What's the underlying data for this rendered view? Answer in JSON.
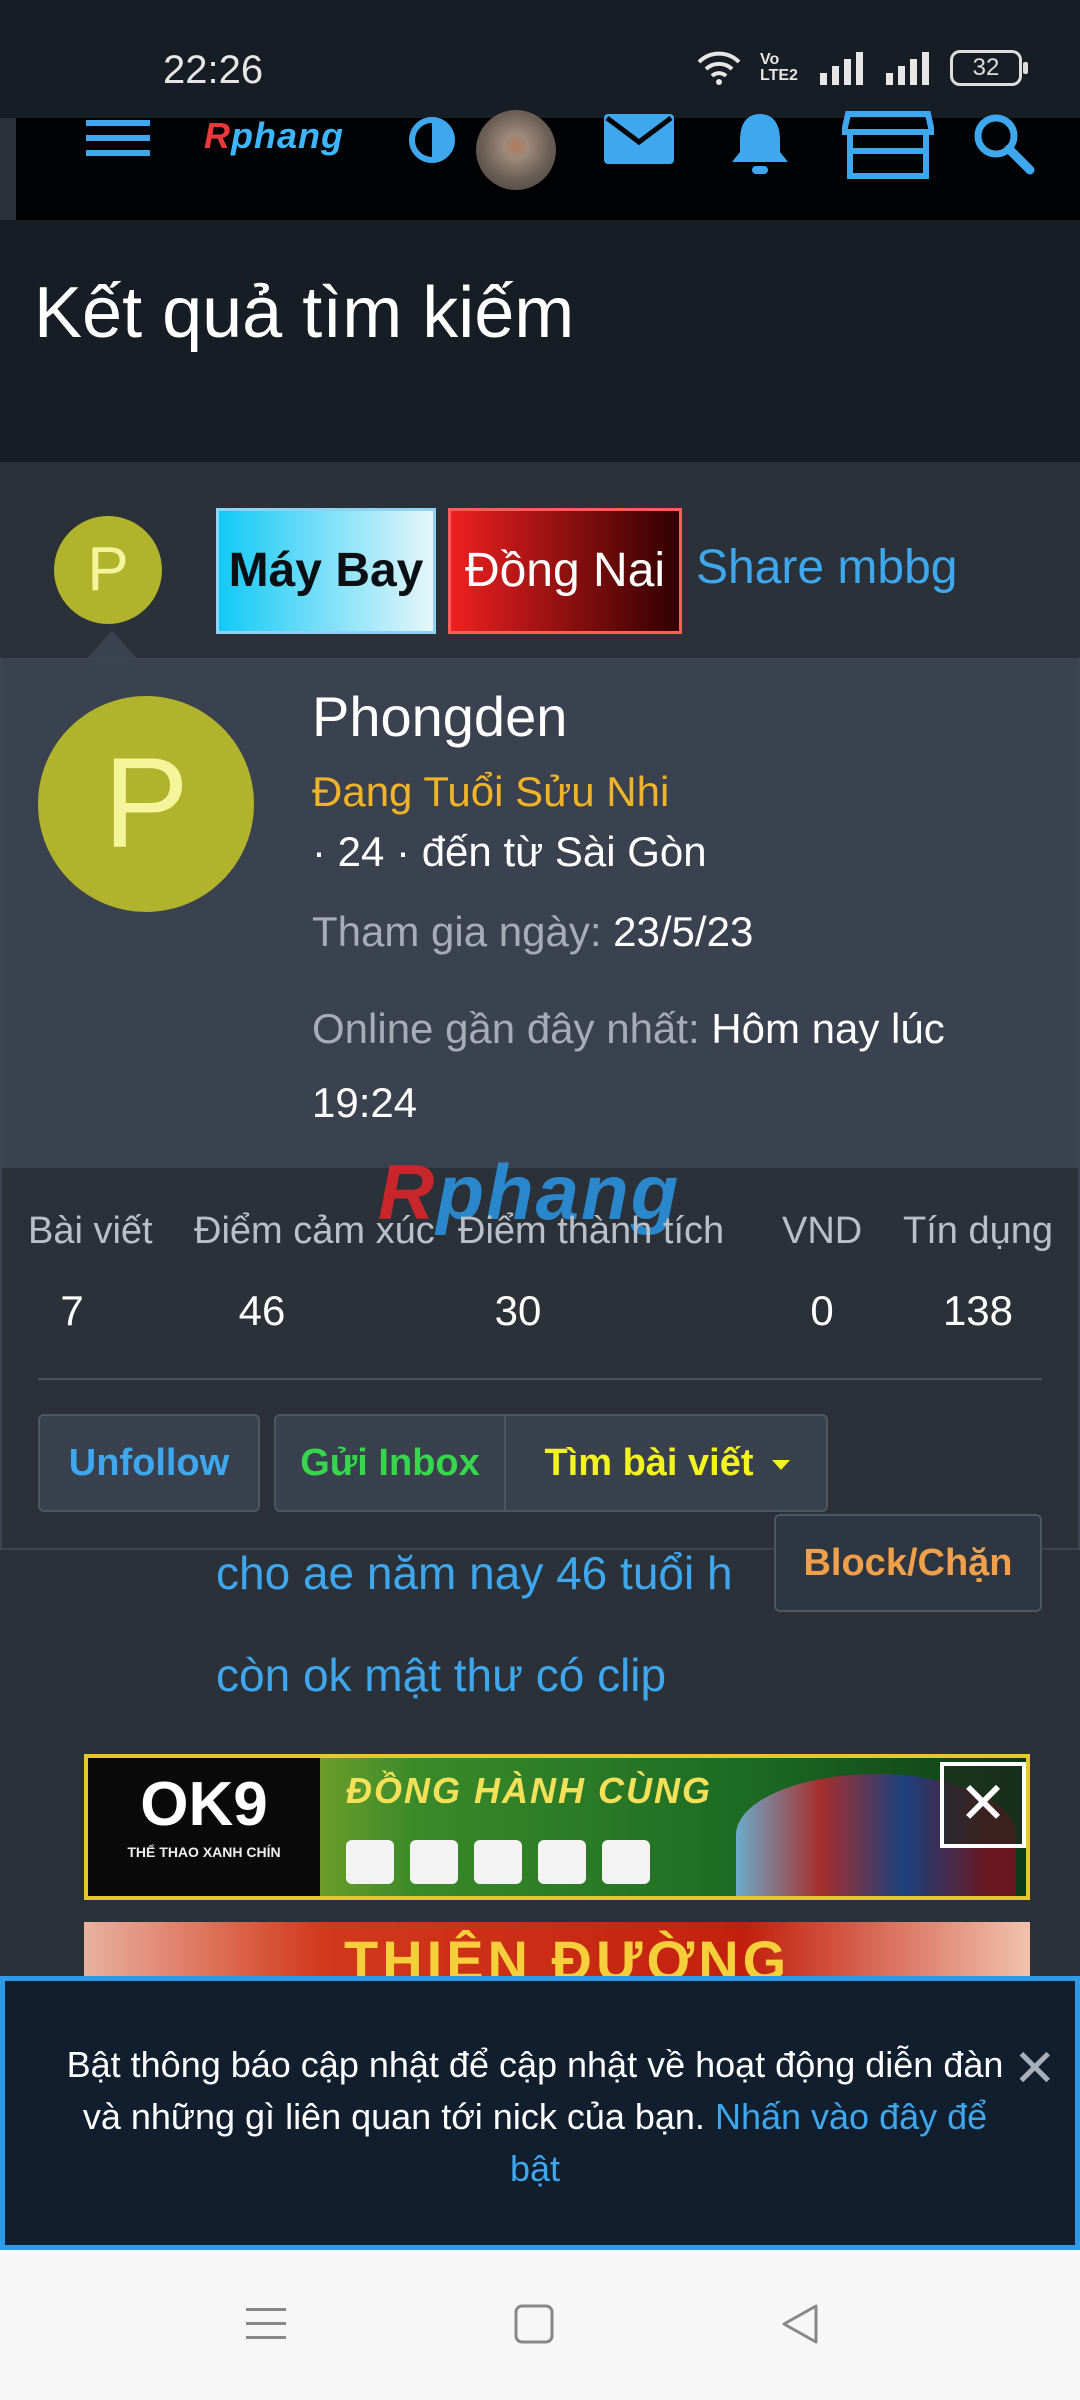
{
  "status_bar": {
    "time": "22:26",
    "battery": "32",
    "network_label": "Vo LTE2",
    "icons": [
      "wifi-icon",
      "volte-icon",
      "signal-icon",
      "signal-icon",
      "battery-icon"
    ]
  },
  "nav": {
    "logo": {
      "part1": "R",
      "part2": "phang"
    },
    "icons": [
      "menu-icon",
      "theme-toggle-icon",
      "avatar",
      "mail-icon",
      "bell-icon",
      "store-icon",
      "search-icon"
    ]
  },
  "page": {
    "title": "Kết quả tìm kiếm"
  },
  "result": {
    "avatar_letter": "P",
    "tags": {
      "maybay": "Máy Bay",
      "dongnai": "Đồng Nai"
    },
    "share_link": "Share mbbg",
    "posts": [
      "cho ae năm nay 46 tuổi h",
      "còn ok mật thư có clip"
    ]
  },
  "profile": {
    "avatar_letter": "P",
    "username": "Phongden",
    "user_title": "Đang Tuổi Sửu Nhi",
    "info": "· 24 · đến từ Sài Gòn",
    "join_label": "Tham gia ngày:",
    "join_value": "23/5/23",
    "online_label": "Online gần đây nhất:",
    "online_value": "Hôm nay lúc 19:24",
    "watermark": {
      "part1": "R",
      "part2": "phang"
    },
    "stats": [
      {
        "label": "Bài viết",
        "value": "7"
      },
      {
        "label": "Điểm cảm xúc",
        "value": "46"
      },
      {
        "label": "Điểm thành tích",
        "value": "30"
      },
      {
        "label": "VND",
        "value": "0"
      },
      {
        "label": "Tín dụng",
        "value": "138"
      }
    ],
    "buttons": {
      "unfollow": "Unfollow",
      "inbox": "Gửi Inbox",
      "find_posts": "Tìm bài viết",
      "block": "Block/Chặn"
    }
  },
  "ads": {
    "banner1": {
      "brand": "OK9",
      "brand_sub": "THỂ THAO XANH CHÍN",
      "slogan": "ĐỒNG HÀNH CÙNG",
      "close": "✕"
    },
    "banner2": {
      "text": "THIÊN ĐƯỜNG"
    }
  },
  "notification": {
    "text": "Bật thông báo cập nhật để cập nhật về hoạt động diễn đàn và những gì liên quan tới nick của bạn.",
    "link": "Nhấn vào đây để bật",
    "close": "✕"
  },
  "colors": {
    "accent": "#3ea7ee",
    "user_title": "#f0b429",
    "inbox": "#36d64d",
    "find_posts": "#f3f31e",
    "block": "#f0a04b",
    "avatar": "#b0b32b"
  }
}
